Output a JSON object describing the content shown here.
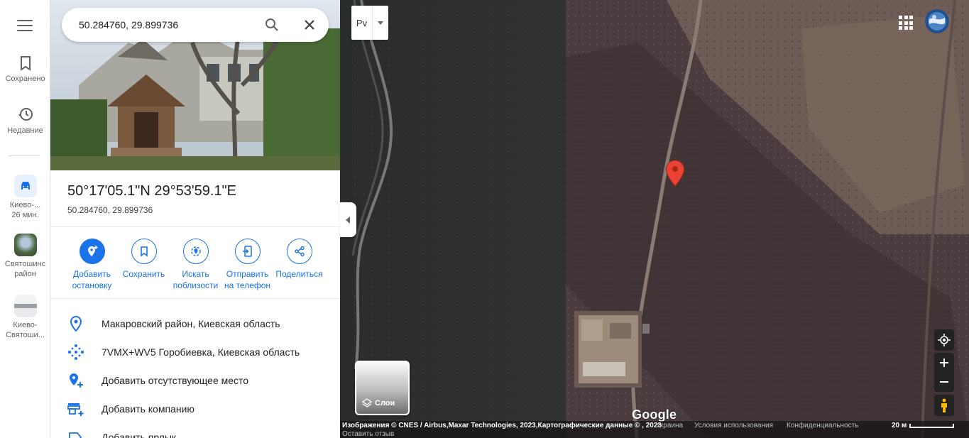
{
  "search": {
    "value": "50.284760, 29.899736"
  },
  "rail": {
    "saved_label": "Сохранено",
    "recent_label": "Недавние",
    "recents": [
      {
        "label1": "Киево-...",
        "label2": "26 мин."
      },
      {
        "label1": "Святошинс",
        "label2": "район"
      },
      {
        "label1": "Киево-",
        "label2": "Святоши..."
      }
    ]
  },
  "place": {
    "title": "50°17'05.1\"N 29°53'59.1\"E",
    "subtitle": "50.284760, 29.899736"
  },
  "actions": [
    {
      "label1": "Добавить",
      "label2": "остановку",
      "icon": "add-stop-icon"
    },
    {
      "label1": "Сохранить",
      "label2": "",
      "icon": "bookmark-icon"
    },
    {
      "label1": "Искать",
      "label2": "поблизости",
      "icon": "nearby-icon"
    },
    {
      "label1": "Отправить",
      "label2": "на телефон",
      "icon": "send-to-phone-icon"
    },
    {
      "label1": "Поделиться",
      "label2": "",
      "icon": "share-icon"
    }
  ],
  "info_rows": [
    {
      "text": "Макаровский район, Киевская область",
      "icon": "location-pin-icon"
    },
    {
      "text": "7VMX+WV5 Горобиевка, Киевская область",
      "icon": "plus-code-icon"
    },
    {
      "text": "Добавить отсутствующее место",
      "icon": "add-place-icon"
    },
    {
      "text": "Добавить компанию",
      "icon": "add-business-icon"
    },
    {
      "text": "Добавить ярлык",
      "icon": "add-label-icon"
    }
  ],
  "map": {
    "language_button": "Pv",
    "layers_label": "Слои",
    "google_logo": "Google",
    "attribution": "Изображения © CNES / Airbus,Maxar Technologies, 2023,Картографические данные © , 2023",
    "feedback": "Оставить отзыв",
    "links": [
      "Украина",
      "Условия использования",
      "Конфиденциальность"
    ],
    "scale_label": "20 м"
  },
  "colors": {
    "accent": "#1a73e8",
    "pin": "#ea4335"
  }
}
